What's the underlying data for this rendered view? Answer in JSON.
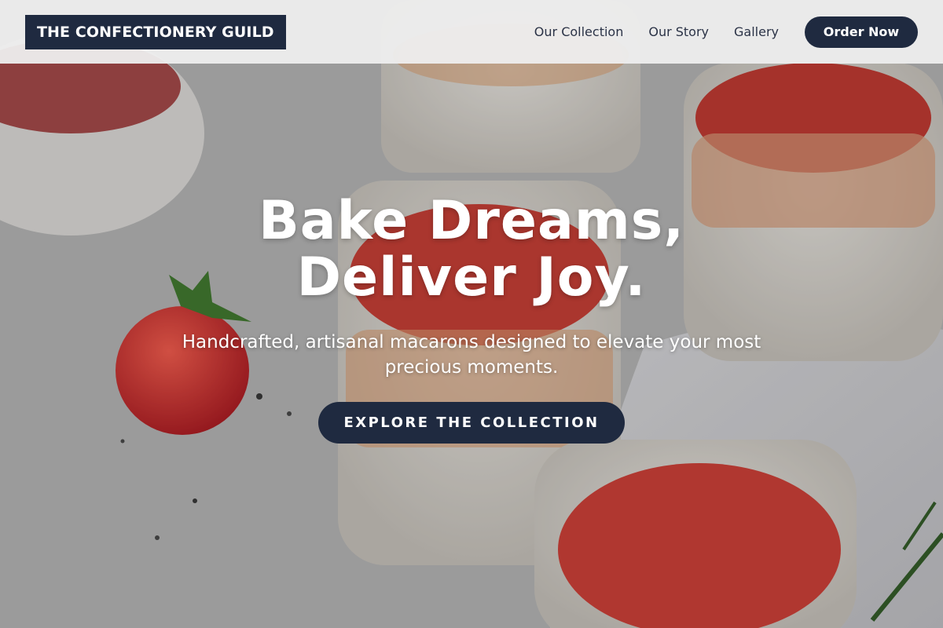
{
  "navbar": {
    "brand": "THE CONFECTIONERY GUILD",
    "links": [
      {
        "label": "Our Collection"
      },
      {
        "label": "Our Story"
      },
      {
        "label": "Gallery"
      }
    ],
    "cta_label": "Order Now"
  },
  "hero": {
    "headline_line1": "Bake Dreams,",
    "headline_line2": "Deliver Joy.",
    "subtitle": "Handcrafted, artisanal macarons designed to elevate your most precious moments.",
    "cta_label": "EXPLORE THE COLLECTION",
    "background_subject": "strawberry-dessert-jars-photo"
  },
  "colors": {
    "brand_navy": "#1f2a40",
    "nav_background": "#eeeeee",
    "hero_text": "#ffffff"
  }
}
